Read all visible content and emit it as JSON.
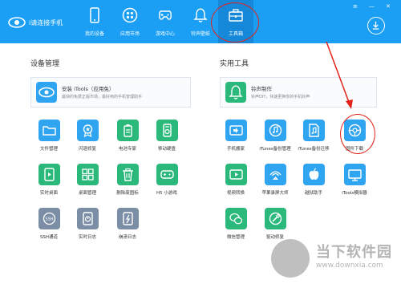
{
  "colors": {
    "bar": "#1a9ff5",
    "active": "#1588d9",
    "annotation": "#e2231a"
  },
  "app": {
    "name": "i请连接手机"
  },
  "nav": [
    {
      "label": "我的设备",
      "icon": "phone-icon"
    },
    {
      "label": "应用市场",
      "icon": "app-market-icon"
    },
    {
      "label": "游戏中心",
      "icon": "gamepad-icon"
    },
    {
      "label": "铃声壁纸",
      "icon": "bell-icon"
    },
    {
      "label": "工具箱",
      "icon": "toolbox-icon",
      "active": true
    }
  ],
  "window": {
    "menu": "≡",
    "minimize": "—",
    "close": "✕"
  },
  "device_mgmt": {
    "title": "设备管理",
    "banner": {
      "title": "安装 iTools（应用免）",
      "subtitle": "最快的免费正版市场，最好用的手机管理助手"
    },
    "tools": [
      {
        "label": "文件管理",
        "color": "#2fa4f0",
        "icon": "folder-icon"
      },
      {
        "label": "闪退修复",
        "color": "#2fa4f0",
        "icon": "badge-icon"
      },
      {
        "label": "电池专家",
        "color": "#2bb87b",
        "icon": "battery-icon"
      },
      {
        "label": "移动硬盘",
        "color": "#2bb87b",
        "icon": "usb-drive-icon"
      },
      {
        "label": "实时桌面",
        "color": "#2bb87b",
        "icon": "play-screen-icon"
      },
      {
        "label": "桌面管理",
        "color": "#2bb87b",
        "icon": "desktop-grid-icon"
      },
      {
        "label": "删除废图标",
        "color": "#2bb87b",
        "icon": "trash-icon"
      },
      {
        "label": "H5 小游戏",
        "color": "#2bb87b",
        "icon": "game-icon"
      },
      {
        "label": "SSH通道",
        "color": "#7b8ea6",
        "icon": "ssh-icon"
      },
      {
        "label": "实时日志",
        "color": "#7b8ea6",
        "icon": "log-icon"
      },
      {
        "label": "崩溃日志",
        "color": "#7b8ea6",
        "icon": "crash-icon"
      }
    ]
  },
  "utilities": {
    "title": "实用工具",
    "banner": {
      "title": "铃声制作",
      "subtitle": "铃声DIY，快速更换你的手机铃声"
    },
    "tools": [
      {
        "label": "手机搬家",
        "color": "#2fa4f0",
        "icon": "phone-transfer-icon"
      },
      {
        "label": "iTunes备份管理",
        "color": "#2fa4f0",
        "icon": "itunes-icon"
      },
      {
        "label": "iTunes备份迁移",
        "color": "#2fa4f0",
        "icon": "music-file-icon"
      },
      {
        "label": "固件下载",
        "color": "#2fa4f0",
        "icon": "firmware-icon"
      },
      {
        "label": "视频转换",
        "color": "#2bb87b",
        "icon": "video-icon"
      },
      {
        "label": "苹果录屏大师",
        "color": "#2fa4f0",
        "icon": "airplay-icon"
      },
      {
        "label": "越狱助手",
        "color": "#2fa4f0",
        "icon": "apple-icon"
      },
      {
        "label": "iTools模拟器",
        "color": "#2fa4f0",
        "icon": "simulator-icon"
      },
      {
        "label": "微信管理",
        "color": "#2bb87b",
        "icon": "wechat-icon"
      },
      {
        "label": "驱动修复",
        "color": "#2bb87b",
        "icon": "repair-icon"
      }
    ]
  },
  "watermark": {
    "name": "当下软件园",
    "url": "www.downxia.com"
  }
}
